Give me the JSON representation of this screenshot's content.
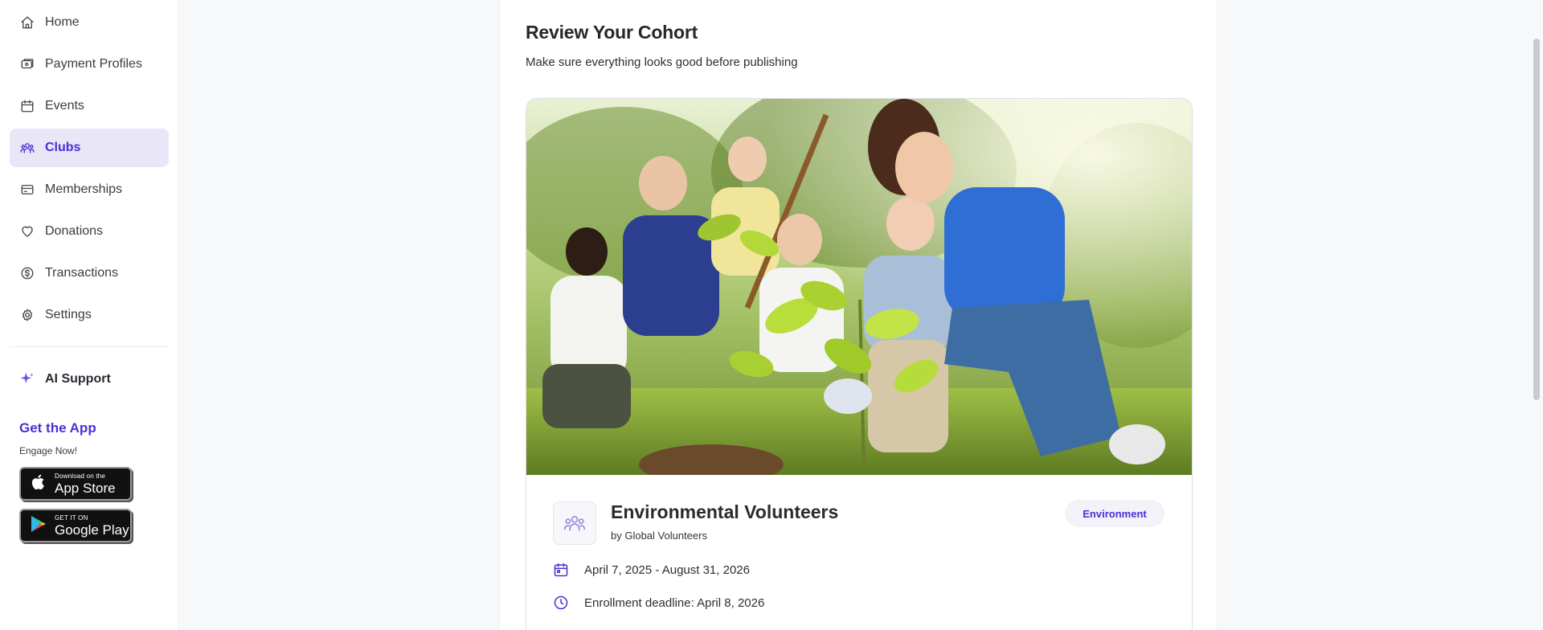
{
  "sidebar": {
    "items": [
      {
        "label": "Home",
        "icon": "home-icon"
      },
      {
        "label": "Payment Profiles",
        "icon": "wallet-icon"
      },
      {
        "label": "Events",
        "icon": "calendar-icon"
      },
      {
        "label": "Clubs",
        "icon": "users-icon",
        "active": true
      },
      {
        "label": "Memberships",
        "icon": "card-icon"
      },
      {
        "label": "Donations",
        "icon": "heart-icon"
      },
      {
        "label": "Transactions",
        "icon": "dollar-icon"
      },
      {
        "label": "Settings",
        "icon": "gear-icon"
      }
    ],
    "ai_support": "AI Support",
    "get_app_title": "Get the App",
    "get_app_sub": "Engage Now!",
    "app_store": {
      "small": "Download on the",
      "big": "App Store"
    },
    "google_play": {
      "small": "GET IT ON",
      "big": "Google Play"
    }
  },
  "main": {
    "title": "Review Your Cohort",
    "subtitle": "Make sure everything looks good before publishing",
    "cohort": {
      "name": "Environmental Volunteers",
      "by": "by Global Volunteers",
      "tag": "Environment",
      "dates": "April 7, 2025 - August 31, 2026",
      "deadline": "Enrollment deadline: April 8, 2026"
    }
  },
  "colors": {
    "accent": "#4b2fd6",
    "active_bg": "#e9e6f8"
  }
}
